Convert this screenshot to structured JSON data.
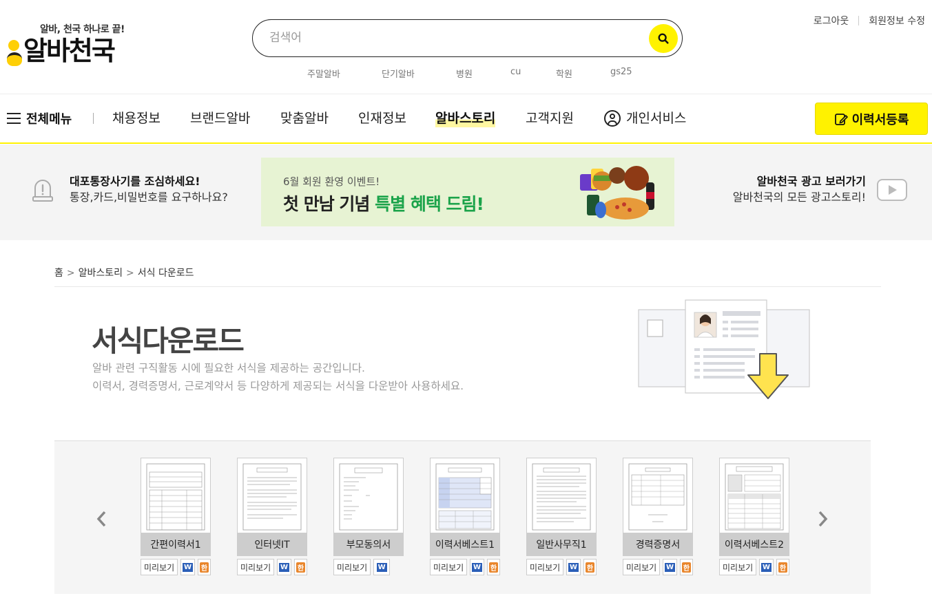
{
  "brand": {
    "tagline": "알바, 천국 하나로 끝!",
    "name": "알바천국"
  },
  "search": {
    "placeholder": "검색어",
    "value": ""
  },
  "keywords": [
    "주말알바",
    "단기알바",
    "병원",
    "cu",
    "학원",
    "gs25"
  ],
  "top_links": {
    "logout": "로그아웃",
    "edit_profile": "회원정보 수정"
  },
  "gnb": {
    "all_menu": "전체메뉴",
    "items": [
      "채용정보",
      "브랜드알바",
      "맞춤알바",
      "인재정보",
      "알바스토리",
      "고객지원"
    ],
    "active": "알바스토리",
    "personal": "개인서비스",
    "resume_button": "이력서등록"
  },
  "notice": {
    "title": "대포통장사기를 조심하세요!",
    "sub": "통장,카드,비밀번호를 요구하나요?"
  },
  "event": {
    "small": "6월 회원 환영 이벤트!",
    "big_part1": "첫 만남 기념 ",
    "big_part2": "특별 혜택 드림!"
  },
  "ad_link": {
    "title": "알바천국 광고 보러가기",
    "sub": "알바천국의 모든 광고스토리!"
  },
  "breadcrumb": {
    "home": "홈",
    "section": "알바스토리",
    "current": "서식 다운로드",
    "separator": ">"
  },
  "page": {
    "title": "서식다운로드",
    "desc_line1": "알바 관련 구직활동 시에 필요한 서식을 제공하는 공간입니다.",
    "desc_line2": "이력서, 경력증명서, 근로계약서 등 다양하게 제공되는 서식을 다운받아 사용하세요."
  },
  "forms": {
    "preview_label": "미리보기",
    "word_label": "W",
    "hwp_label": "한",
    "items": [
      {
        "name": "간편이력서1",
        "has_hwp": true
      },
      {
        "name": "인터넷IT",
        "has_hwp": true
      },
      {
        "name": "부모동의서",
        "has_hwp": false
      },
      {
        "name": "이력서베스트1",
        "has_hwp": true
      },
      {
        "name": "일반사무직1",
        "has_hwp": true
      },
      {
        "name": "경력증명서",
        "has_hwp": true
      },
      {
        "name": "이력서베스트2",
        "has_hwp": true
      }
    ]
  },
  "colors": {
    "accent_yellow": "#fff200",
    "event_bg": "#e7f3d3",
    "event_green": "#1ba34a",
    "word_blue": "#2b5fb8",
    "hwp_orange": "#e9862c"
  }
}
